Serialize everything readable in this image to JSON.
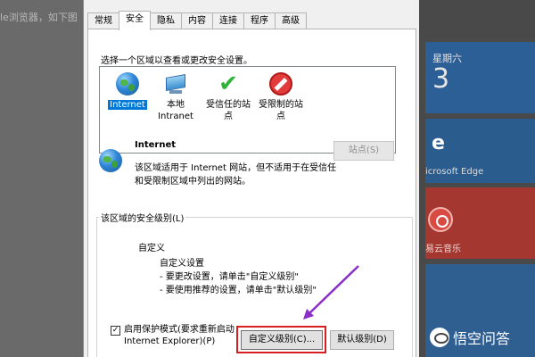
{
  "background": {
    "article_text": "le浏览器，如下图",
    "tiles": {
      "date_label": "星期六",
      "date_number": "3",
      "edge_label": "icrosoft Edge",
      "music_label": "易云音乐"
    },
    "watermark": "悟空问答"
  },
  "dialog": {
    "tabs": [
      {
        "label": "常规",
        "active": false
      },
      {
        "label": "安全",
        "active": true
      },
      {
        "label": "隐私",
        "active": false
      },
      {
        "label": "内容",
        "active": false
      },
      {
        "label": "连接",
        "active": false
      },
      {
        "label": "程序",
        "active": false
      },
      {
        "label": "高级",
        "active": false
      }
    ],
    "zone_prompt": "选择一个区域以查看或更改安全设置。",
    "zones": [
      {
        "label": "Internet",
        "icon": "globe-icon",
        "selected": true
      },
      {
        "label": "本地\nIntranet",
        "icon": "intranet-icon",
        "selected": false
      },
      {
        "label": "受信任的站\n点",
        "icon": "check-icon",
        "selected": false
      },
      {
        "label": "受限制的站\n点",
        "icon": "restricted-icon",
        "selected": false
      }
    ],
    "zone_detail": {
      "title": "Internet",
      "description": "该区域适用于 Internet 网站，但不适用于在受信任和受限制区域中列出的网站。",
      "sites_button": "站点(S)"
    },
    "security_level": {
      "group_label": "该区域的安全级别(L)",
      "level_title": "自定义",
      "lines": [
        "自定义设置",
        "- 要更改设置，请单击\"自定义级别\"",
        "- 要使用推荐的设置，请单击\"默认级别\""
      ]
    },
    "protected_mode": {
      "checked": true,
      "line1": "启用保护模式(要求重新启动",
      "line2": "Internet Explorer)(P)"
    },
    "buttons": {
      "custom_level": "自定义级别(C)...",
      "default_level": "默认级别(D)"
    }
  },
  "colors": {
    "highlight": "#d81e1e",
    "arrow": "#8b2fc9",
    "selection": "#0078d7"
  }
}
